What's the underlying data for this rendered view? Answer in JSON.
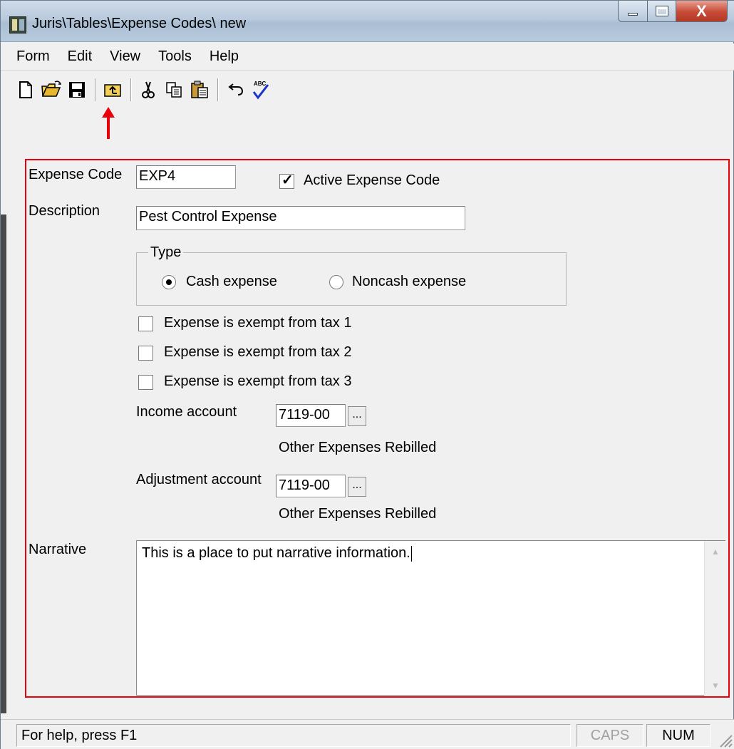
{
  "window": {
    "title": "Juris\\Tables\\Expense Codes\\ new",
    "close_glyph": "X"
  },
  "menu": [
    "Form",
    "Edit",
    "View",
    "Tools",
    "Help"
  ],
  "toolbar": {
    "icons": [
      "new-document-icon",
      "open-folder-icon",
      "save-disk-icon",
      "up-folder-icon",
      "cut-scissors-icon",
      "copy-icon",
      "paste-icon",
      "undo-icon",
      "spellcheck-icon"
    ]
  },
  "form": {
    "expense_code_label": "Expense Code",
    "expense_code_value": "EXP4",
    "active_label": "Active Expense Code",
    "active_checked": true,
    "description_label": "Description",
    "description_value": "Pest Control Expense",
    "type_label": "Type",
    "type_options": [
      {
        "label": "Cash expense",
        "selected": true
      },
      {
        "label": "Noncash expense",
        "selected": false
      }
    ],
    "tax_exemptions": [
      {
        "label": "Expense is exempt from tax 1",
        "checked": false
      },
      {
        "label": "Expense is exempt from tax 2",
        "checked": false
      },
      {
        "label": "Expense is exempt from tax 3",
        "checked": false
      }
    ],
    "income_account_label": "Income account",
    "income_account_value": "7119-00",
    "income_account_name": "Other Expenses Rebilled",
    "adjustment_account_label": "Adjustment account",
    "adjustment_account_value": "7119-00",
    "adjustment_account_name": "Other Expenses Rebilled",
    "browse_label": "...",
    "narrative_label": "Narrative",
    "narrative_value": "This is a place to put narrative information."
  },
  "status": {
    "help_text": "For help, press F1",
    "caps": "CAPS",
    "num": "NUM"
  },
  "colors": {
    "highlight_frame": "#e8000b",
    "arrow": "#e8000b"
  }
}
